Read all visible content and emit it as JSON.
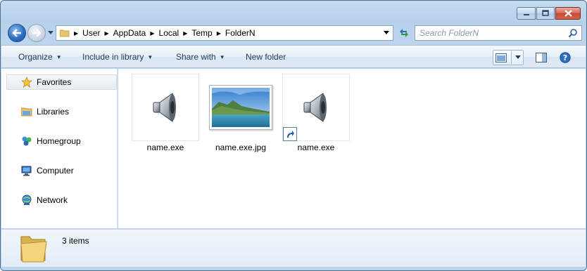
{
  "window": {
    "caption": {
      "minimize": "▬",
      "maximize": "❐",
      "close": "✕"
    }
  },
  "address": {
    "crumbs": [
      "User",
      "AppData",
      "Local",
      "Temp",
      "FolderN"
    ]
  },
  "search": {
    "placeholder": "Search FolderN"
  },
  "toolbar": {
    "organize": "Organize",
    "include_in_library": "Include in library",
    "share_with": "Share with",
    "new_folder": "New folder"
  },
  "sidebar": {
    "items": [
      {
        "label": "Favorites",
        "icon": "star-icon",
        "selected": true
      },
      {
        "label": "Libraries",
        "icon": "libraries-icon"
      },
      {
        "label": "Homegroup",
        "icon": "homegroup-icon"
      },
      {
        "label": "Computer",
        "icon": "computer-icon"
      },
      {
        "label": "Network",
        "icon": "network-icon"
      }
    ]
  },
  "files": [
    {
      "name": "name.exe",
      "type": "audio",
      "icon": "speaker-icon"
    },
    {
      "name": "name.exe.jpg",
      "type": "image",
      "icon": "landscape-thumbnail"
    },
    {
      "name": "name.exe",
      "type": "audio-shortcut",
      "icon": "speaker-icon"
    }
  ],
  "details": {
    "count": "3 items"
  },
  "colors": {
    "accent": "#1e395b",
    "frame": "#bcd4ec"
  }
}
